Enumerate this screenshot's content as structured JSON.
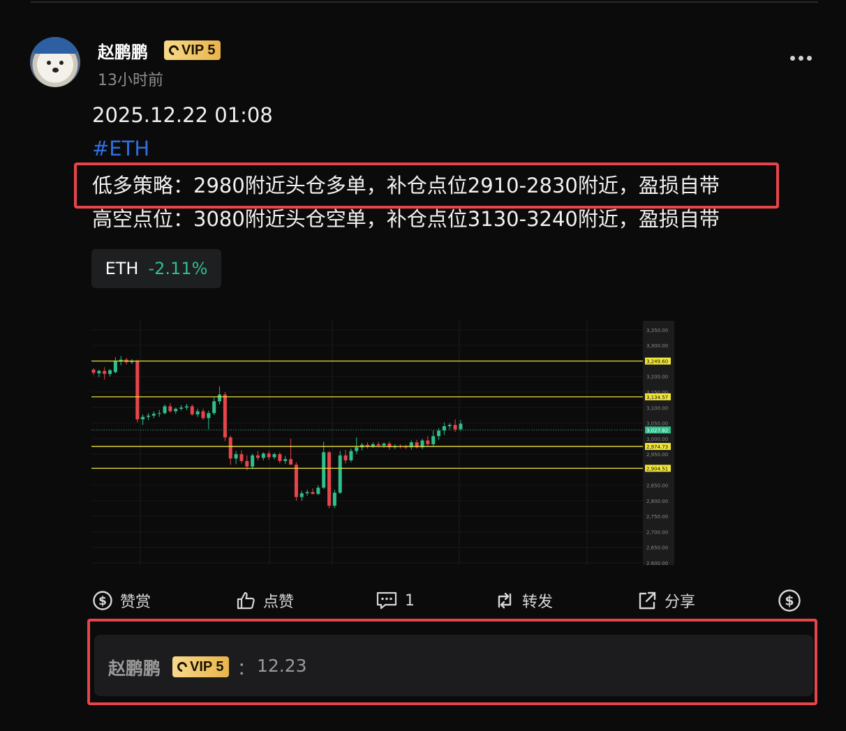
{
  "post": {
    "username": "赵鹏鹏",
    "vip": "VIP 5",
    "time_ago": "13小时前",
    "lines": [
      "2025.12.22 01:08",
      "#ETH",
      "低多策略：2980附近头仓多单，补仓点位2910-2830附近，盈损自带",
      "高空点位：3080附近头仓空单，补仓点位3130-3240附近，盈损自带"
    ]
  },
  "ticker": {
    "symbol": "ETH",
    "change": "-2.11%",
    "change_color": "#2fbf8b"
  },
  "colors": {
    "up": "#2fbf8b",
    "down": "#e8454b",
    "highlight_box": "#e8454b",
    "level_line": "#f0e53a",
    "vip_gold": "#e9b44c"
  },
  "chart_data": {
    "type": "candlestick",
    "y_axis_ticks": [
      "3,350.00",
      "3,300.00",
      "3,250.00",
      "3,200.00",
      "3,150.00",
      "3,100.00",
      "3,050.00",
      "3,000.00",
      "2,950.00",
      "2,900.00",
      "2,850.00",
      "2,800.00",
      "2,750.00",
      "2,700.00",
      "2,650.00",
      "2,600.00"
    ],
    "ylim": [
      2600,
      3370
    ],
    "levels": [
      {
        "label": "3,249.60",
        "value": 3249.6
      },
      {
        "label": "3,134.57",
        "value": 3134.57
      },
      {
        "label": "2,974.73",
        "value": 2974.73
      },
      {
        "label": "2,904.51",
        "value": 2904.51
      }
    ],
    "current_price": {
      "label": "3,027.82",
      "value": 3027.82
    },
    "candles": [
      {
        "o": 3222,
        "h": 3226,
        "l": 3205,
        "c": 3212
      },
      {
        "o": 3210,
        "h": 3222,
        "l": 3198,
        "c": 3218
      },
      {
        "o": 3218,
        "h": 3230,
        "l": 3190,
        "c": 3208
      },
      {
        "o": 3208,
        "h": 3224,
        "l": 3200,
        "c": 3220
      },
      {
        "o": 3214,
        "h": 3262,
        "l": 3210,
        "c": 3248
      },
      {
        "o": 3248,
        "h": 3266,
        "l": 3236,
        "c": 3254
      },
      {
        "o": 3254,
        "h": 3260,
        "l": 3238,
        "c": 3246
      },
      {
        "o": 3246,
        "h": 3256,
        "l": 3240,
        "c": 3250
      },
      {
        "o": 3250,
        "h": 3254,
        "l": 3052,
        "c": 3062
      },
      {
        "o": 3062,
        "h": 3078,
        "l": 3044,
        "c": 3070
      },
      {
        "o": 3070,
        "h": 3082,
        "l": 3060,
        "c": 3074
      },
      {
        "o": 3074,
        "h": 3088,
        "l": 3066,
        "c": 3080
      },
      {
        "o": 3080,
        "h": 3092,
        "l": 3070,
        "c": 3082
      },
      {
        "o": 3082,
        "h": 3110,
        "l": 3078,
        "c": 3104
      },
      {
        "o": 3104,
        "h": 3114,
        "l": 3084,
        "c": 3088
      },
      {
        "o": 3088,
        "h": 3100,
        "l": 3080,
        "c": 3096
      },
      {
        "o": 3096,
        "h": 3108,
        "l": 3090,
        "c": 3100
      },
      {
        "o": 3100,
        "h": 3112,
        "l": 3092,
        "c": 3104
      },
      {
        "o": 3104,
        "h": 3110,
        "l": 3074,
        "c": 3078
      },
      {
        "o": 3078,
        "h": 3096,
        "l": 3070,
        "c": 3088
      },
      {
        "o": 3088,
        "h": 3096,
        "l": 3060,
        "c": 3066
      },
      {
        "o": 3066,
        "h": 3090,
        "l": 3030,
        "c": 3082
      },
      {
        "o": 3082,
        "h": 3132,
        "l": 3076,
        "c": 3120
      },
      {
        "o": 3120,
        "h": 3168,
        "l": 3110,
        "c": 3142
      },
      {
        "o": 3142,
        "h": 3150,
        "l": 2992,
        "c": 3004
      },
      {
        "o": 3004,
        "h": 3010,
        "l": 2916,
        "c": 2936
      },
      {
        "o": 2936,
        "h": 2960,
        "l": 2918,
        "c": 2950
      },
      {
        "o": 2950,
        "h": 2962,
        "l": 2920,
        "c": 2928
      },
      {
        "o": 2928,
        "h": 2946,
        "l": 2898,
        "c": 2910
      },
      {
        "o": 2910,
        "h": 2952,
        "l": 2902,
        "c": 2946
      },
      {
        "o": 2946,
        "h": 2960,
        "l": 2930,
        "c": 2938
      },
      {
        "o": 2938,
        "h": 2956,
        "l": 2930,
        "c": 2952
      },
      {
        "o": 2952,
        "h": 2960,
        "l": 2932,
        "c": 2940
      },
      {
        "o": 2940,
        "h": 2954,
        "l": 2934,
        "c": 2950
      },
      {
        "o": 2950,
        "h": 2956,
        "l": 2920,
        "c": 2928
      },
      {
        "o": 2928,
        "h": 2944,
        "l": 2918,
        "c": 2934
      },
      {
        "o": 2934,
        "h": 3000,
        "l": 2918,
        "c": 2916
      },
      {
        "o": 2916,
        "h": 2924,
        "l": 2800,
        "c": 2812
      },
      {
        "o": 2812,
        "h": 2832,
        "l": 2800,
        "c": 2824
      },
      {
        "o": 2824,
        "h": 2836,
        "l": 2816,
        "c": 2828
      },
      {
        "o": 2828,
        "h": 2840,
        "l": 2820,
        "c": 2822
      },
      {
        "o": 2822,
        "h": 2850,
        "l": 2818,
        "c": 2842
      },
      {
        "o": 2842,
        "h": 2990,
        "l": 2838,
        "c": 2956
      },
      {
        "o": 2956,
        "h": 2960,
        "l": 2776,
        "c": 2784
      },
      {
        "o": 2784,
        "h": 2836,
        "l": 2776,
        "c": 2826
      },
      {
        "o": 2826,
        "h": 2960,
        "l": 2822,
        "c": 2946
      },
      {
        "o": 2946,
        "h": 2964,
        "l": 2920,
        "c": 2930
      },
      {
        "o": 2930,
        "h": 2968,
        "l": 2924,
        "c": 2960
      },
      {
        "o": 2960,
        "h": 3004,
        "l": 2950,
        "c": 2972
      },
      {
        "o": 2972,
        "h": 2986,
        "l": 2962,
        "c": 2980
      },
      {
        "o": 2980,
        "h": 2988,
        "l": 2968,
        "c": 2976
      },
      {
        "o": 2976,
        "h": 2988,
        "l": 2970,
        "c": 2982
      },
      {
        "o": 2982,
        "h": 2990,
        "l": 2972,
        "c": 2978
      },
      {
        "o": 2978,
        "h": 2988,
        "l": 2970,
        "c": 2984
      },
      {
        "o": 2984,
        "h": 2990,
        "l": 2964,
        "c": 2972
      },
      {
        "o": 2972,
        "h": 2982,
        "l": 2966,
        "c": 2976
      },
      {
        "o": 2976,
        "h": 2982,
        "l": 2968,
        "c": 2974
      },
      {
        "o": 2974,
        "h": 2980,
        "l": 2966,
        "c": 2972
      },
      {
        "o": 2972,
        "h": 2994,
        "l": 2964,
        "c": 2988
      },
      {
        "o": 2988,
        "h": 2996,
        "l": 2968,
        "c": 2972
      },
      {
        "o": 2972,
        "h": 3000,
        "l": 2966,
        "c": 2994
      },
      {
        "o": 2994,
        "h": 3008,
        "l": 2976,
        "c": 2982
      },
      {
        "o": 2982,
        "h": 3026,
        "l": 2976,
        "c": 3008
      },
      {
        "o": 3008,
        "h": 3034,
        "l": 2996,
        "c": 3026
      },
      {
        "o": 3026,
        "h": 3052,
        "l": 3012,
        "c": 3040
      },
      {
        "o": 3040,
        "h": 3050,
        "l": 3030,
        "c": 3044
      },
      {
        "o": 3044,
        "h": 3062,
        "l": 3022,
        "c": 3030
      },
      {
        "o": 3030,
        "h": 3060,
        "l": 3024,
        "c": 3048
      }
    ]
  },
  "actions": {
    "tip": "赞赏",
    "like": "点赞",
    "comment_count": "1",
    "repost": "转发",
    "share": "分享"
  },
  "comment": {
    "username": "赵鹏鹏",
    "vip": "VIP 5",
    "colon": "：",
    "text": "12.23"
  }
}
